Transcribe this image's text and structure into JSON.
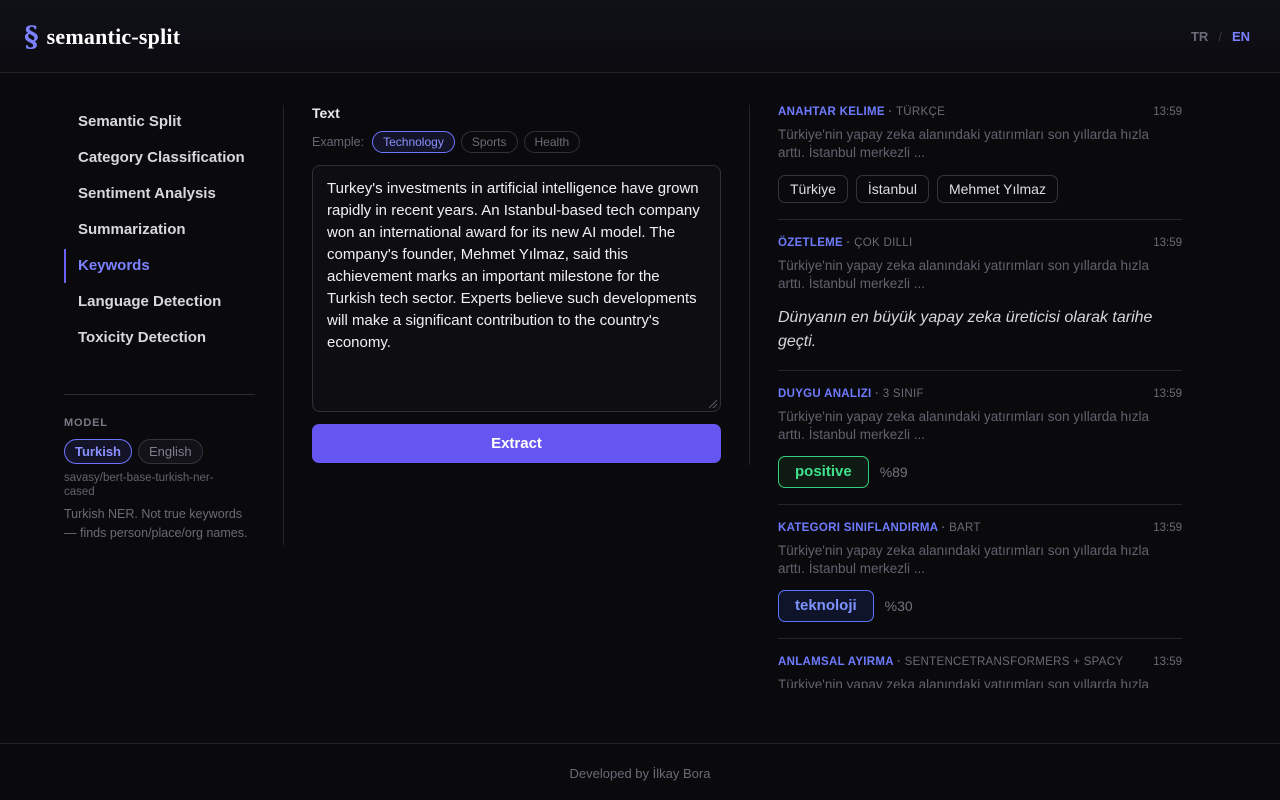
{
  "header": {
    "logo_mark": "§",
    "title": "semantic-split",
    "lang": {
      "tr": "TR",
      "sep": "/",
      "en": "EN",
      "active": "EN"
    }
  },
  "sidebar": {
    "items": [
      {
        "label": "Semantic Split"
      },
      {
        "label": "Category Classification"
      },
      {
        "label": "Sentiment Analysis"
      },
      {
        "label": "Summarization"
      },
      {
        "label": "Keywords",
        "active": true
      },
      {
        "label": "Language Detection"
      },
      {
        "label": "Toxicity Detection"
      }
    ],
    "model": {
      "label": "MODEL",
      "options": [
        "Turkish",
        "English"
      ],
      "selected": "Turkish",
      "id": "savasy/bert-base-turkish-ner-cased",
      "description": "Turkish NER. Not true keywords — finds person/place/org names."
    }
  },
  "main": {
    "text_label": "Text",
    "example_label": "Example:",
    "examples": [
      "Technology",
      "Sports",
      "Health"
    ],
    "selected_example": "Technology",
    "input_text": "Turkey's investments in artificial intelligence have grown rapidly in recent years. An Istanbul-based tech company won an international award for its new AI model. The company's founder, Mehmet Yılmaz, said this achievement marks an important milestone for the Turkish tech sector. Experts believe such developments will make a significant contribution to the country's economy.",
    "extract_label": "Extract"
  },
  "history": [
    {
      "kind": "ANAHTAR KELIME",
      "sub": "TÜRKÇE",
      "time": "13:59",
      "snippet": "Türkiye'nin yapay zeka alanındaki yatırımları son yıllarda hızla arttı. İstanbul merkezli ...",
      "tags": [
        "Türkiye",
        "İstanbul",
        "Mehmet Yılmaz"
      ]
    },
    {
      "kind": "ÖZETLEME",
      "sub": "ÇOK DILLI",
      "time": "13:59",
      "snippet": "Türkiye'nin yapay zeka alanındaki yatırımları son yıllarda hızla arttı. İstanbul merkezli ...",
      "summary": "Dünyanın en büyük yapay zeka üreticisi olarak tarihe geçti."
    },
    {
      "kind": "DUYGU ANALIZI",
      "sub": "3 SINIF",
      "time": "13:59",
      "snippet": "Türkiye'nin yapay zeka alanındaki yatırımları son yıllarda hızla arttı. İstanbul merkezli ...",
      "result": "positive",
      "pct": "%89"
    },
    {
      "kind": "KATEGORI SINIFLANDIRMA",
      "sub": "BART",
      "time": "13:59",
      "snippet": "Türkiye'nin yapay zeka alanındaki yatırımları son yıllarda hızla arttı. İstanbul merkezli ...",
      "result": "teknoloji",
      "pct": "%30"
    },
    {
      "kind": "ANLAMSAL AYIRMA",
      "sub": "SENTENCETRANSFORMERS + SPACY",
      "time": "13:59",
      "snippet": "Türkiye'nin yapay zeka alanındaki yatırımları son yıllarda hızla arttı. İstanbul merkezli ..."
    }
  ],
  "footer": {
    "text": "Developed by İlkay Bora"
  }
}
